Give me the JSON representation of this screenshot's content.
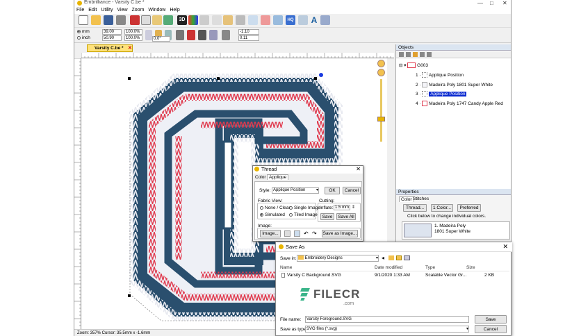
{
  "app": {
    "title": "Embrilliance - Varsity C.be *",
    "menu": [
      "File",
      "Edit",
      "Utility",
      "View",
      "Zoom",
      "Window",
      "Help"
    ],
    "toolbar2": {
      "unit_mm": "mm",
      "unit_inch": "inch",
      "width": "39.00",
      "height": "50.90",
      "scale_w": "100.0%",
      "scale_h": "100.0%",
      "angle": "0.0°",
      "pos_x": "-1.10",
      "pos_y": "0.11"
    },
    "doc_tab": "Varsity C.be *",
    "status": "Zoom: 357%  Cursor: 35.5mm x -1.6mm"
  },
  "objects_panel": {
    "title": "Objects",
    "group": "G003",
    "items": [
      {
        "num": "1",
        "label": "Applique Position",
        "selected": false
      },
      {
        "num": "2",
        "label": "Madeira Poly 1801 Super White",
        "selected": false
      },
      {
        "num": "3",
        "label": "Applique Position",
        "selected": true
      },
      {
        "num": "4",
        "label": "Madeira Poly 1747 Candy Apple Red",
        "selected": false
      }
    ]
  },
  "properties_panel": {
    "title": "Properties",
    "tabs": [
      "Color",
      "Stitches"
    ],
    "buttons": [
      "Thread...",
      "1 Color...",
      "Preferred"
    ],
    "hint": "Click below to change individual colors.",
    "swatch_label_1": "1. Madeira Poly",
    "swatch_label_2": "1801 Super White"
  },
  "thread_dialog": {
    "title": "Thread",
    "tabs": [
      "Color",
      "Applique"
    ],
    "style_label": "Style:",
    "style_value": "Applique Position",
    "ok": "OK",
    "cancel": "Cancel",
    "fabric_view_label": "Fabric View:",
    "opt_none": "None / Clear",
    "opt_single": "Single Image",
    "opt_simulated": "Simulated",
    "opt_tiled": "Tiled Image",
    "cutting_label": "Cutting:",
    "inflate_label": "Inflate:",
    "inflate_value": "1.5 mm",
    "save": "Save",
    "save_all": "Save All",
    "image_label": "Image:",
    "image_btn": "Image...",
    "save_as_image": "Save as Image..."
  },
  "saveas_dialog": {
    "title": "Save As",
    "save_in_label": "Save in:",
    "save_in_value": "Embroidery Designs",
    "columns": [
      "Name",
      "Date modified",
      "Type",
      "Size"
    ],
    "file": {
      "name": "Varsity C Background.SVG",
      "date": "9/1/2020 1:33 AM",
      "type": "Scalable Vector Gr...",
      "size": "2 KB"
    },
    "file_name_label": "File name:",
    "file_name_value": "Varsity Foreground.SVG",
    "save_type_label": "Save as type:",
    "save_type_value": "SVG files (*.svg)",
    "save": "Save",
    "cancel": "Cancel",
    "close": "✕"
  },
  "watermark": "FILECR",
  "watermark_sub": ".com",
  "colors": {
    "navy": "#2a4f6e",
    "red": "#e03a4e",
    "white": "#f4f4f8",
    "select": "#0a2ad0",
    "tab": "#ffe27a"
  }
}
